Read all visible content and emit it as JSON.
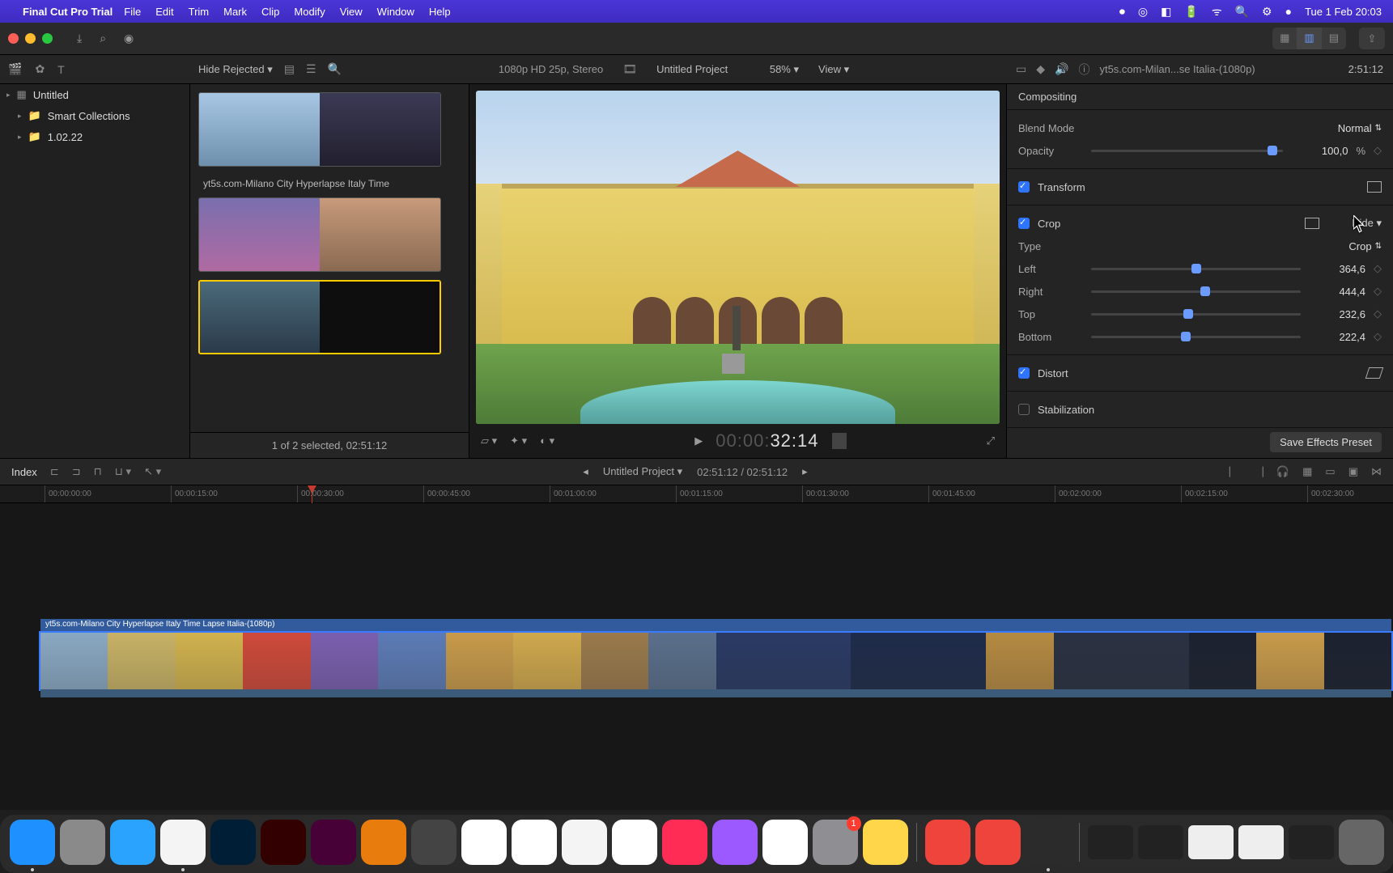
{
  "menubar": {
    "app": "Final Cut Pro Trial",
    "items": [
      "File",
      "Edit",
      "Trim",
      "Mark",
      "Clip",
      "Modify",
      "View",
      "Window",
      "Help"
    ],
    "clock": "Tue 1 Feb  20:03"
  },
  "seg_labels": [
    "grid",
    "list",
    "film"
  ],
  "secbar": {
    "filter": "Hide Rejected",
    "format": "1080p HD 25p, Stereo",
    "project": "Untitled Project",
    "zoom": "58%",
    "view": "View",
    "inspector_file": "yt5s.com-Milan...se Italia-(1080p)",
    "inspector_tc": "2:51:12"
  },
  "sidebar": {
    "items": [
      {
        "icon": "▸",
        "glyph": "▦",
        "label": "Untitled"
      },
      {
        "icon": "▸",
        "glyph": "📁",
        "label": "Smart Collections"
      },
      {
        "icon": "▸",
        "glyph": "📁",
        "label": "1.02.22"
      }
    ]
  },
  "clips": {
    "name": "yt5s.com-Milano City Hyperlapse Italy Time",
    "status": "1 of 2 selected, 02:51:12"
  },
  "viewer": {
    "tc_grey": "00:00:",
    "tc_white": "32:14"
  },
  "inspector": {
    "compositing": "Compositing",
    "blend_label": "Blend Mode",
    "blend_value": "Normal",
    "opacity_label": "Opacity",
    "opacity_value": "100,0",
    "opacity_unit": "%",
    "transform": "Transform",
    "crop": "Crop",
    "crop_hide": "Hide",
    "type_label": "Type",
    "type_value": "Crop",
    "rows": [
      {
        "label": "Left",
        "value": "364,6",
        "pos": 48
      },
      {
        "label": "Right",
        "value": "444,4",
        "pos": 52
      },
      {
        "label": "Top",
        "value": "232,6",
        "pos": 44
      },
      {
        "label": "Bottom",
        "value": "222,4",
        "pos": 43
      }
    ],
    "distort": "Distort",
    "stabilization": "Stabilization",
    "preset": "Save Effects Preset"
  },
  "timeline": {
    "index": "Index",
    "project": "Untitled Project",
    "tc": "02:51:12 / 02:51:12",
    "clip_title": "yt5s.com-Milano City Hyperlapse Italy Time Lapse Italia-(1080p)",
    "ticks": [
      "00:00:00:00",
      "00:00:15:00",
      "00:00:30:00",
      "00:00:45:00",
      "00:01:00:00",
      "00:01:15:00",
      "00:01:30:00",
      "00:01:45:00",
      "00:02:00:00",
      "00:02:15:00",
      "00:02:30:00"
    ]
  },
  "dock": {
    "apps": [
      {
        "name": "finder",
        "color": "#1e90ff"
      },
      {
        "name": "launchpad",
        "color": "#8a8a8a"
      },
      {
        "name": "safari",
        "color": "#2aa3ff"
      },
      {
        "name": "chrome",
        "color": "#f4f4f4"
      },
      {
        "name": "photoshop",
        "color": "#001e36"
      },
      {
        "name": "illustrator",
        "color": "#330000"
      },
      {
        "name": "xd",
        "color": "#470137"
      },
      {
        "name": "blender",
        "color": "#e87d0d"
      },
      {
        "name": "krita",
        "color": "#444"
      },
      {
        "name": "messenger",
        "color": "#fff"
      },
      {
        "name": "mail",
        "color": "#fff"
      },
      {
        "name": "maps",
        "color": "#f4f4f4"
      },
      {
        "name": "photos",
        "color": "#fff"
      },
      {
        "name": "music",
        "color": "#ff2d55"
      },
      {
        "name": "podcasts",
        "color": "#9b59ff"
      },
      {
        "name": "numbers",
        "color": "#fff"
      },
      {
        "name": "settings",
        "color": "#8e8e93",
        "badge": "1"
      },
      {
        "name": "notes",
        "color": "#ffd54a"
      }
    ],
    "apps2": [
      {
        "name": "anydesk",
        "color": "#ef443b"
      },
      {
        "name": "anydesk2",
        "color": "#ef443b"
      },
      {
        "name": "finalcut",
        "color": "#2b2b2b",
        "running": true
      }
    ],
    "mini": [
      {
        "name": "win1",
        "color": "#222"
      },
      {
        "name": "win2",
        "color": "#222"
      },
      {
        "name": "win3",
        "color": "#eee"
      },
      {
        "name": "win4",
        "color": "#eee"
      },
      {
        "name": "win5",
        "color": "#222"
      }
    ],
    "trash": {
      "name": "trash",
      "color": "#666"
    }
  },
  "film_colors": [
    "#89a8c2",
    "#c7b265",
    "#d0b24e",
    "#ce4a3a",
    "#7a5fae",
    "#5c7bb5",
    "#c79a4a",
    "#cfa84d",
    "#9a7a4c",
    "#5a6f8b",
    "#2a3a64",
    "#2a3a64",
    "#1e2b4a",
    "#1e2b4a",
    "#b58a42",
    "#2a3142",
    "#2a3142",
    "#1c2230",
    "#c79a4a",
    "#1c2230"
  ]
}
